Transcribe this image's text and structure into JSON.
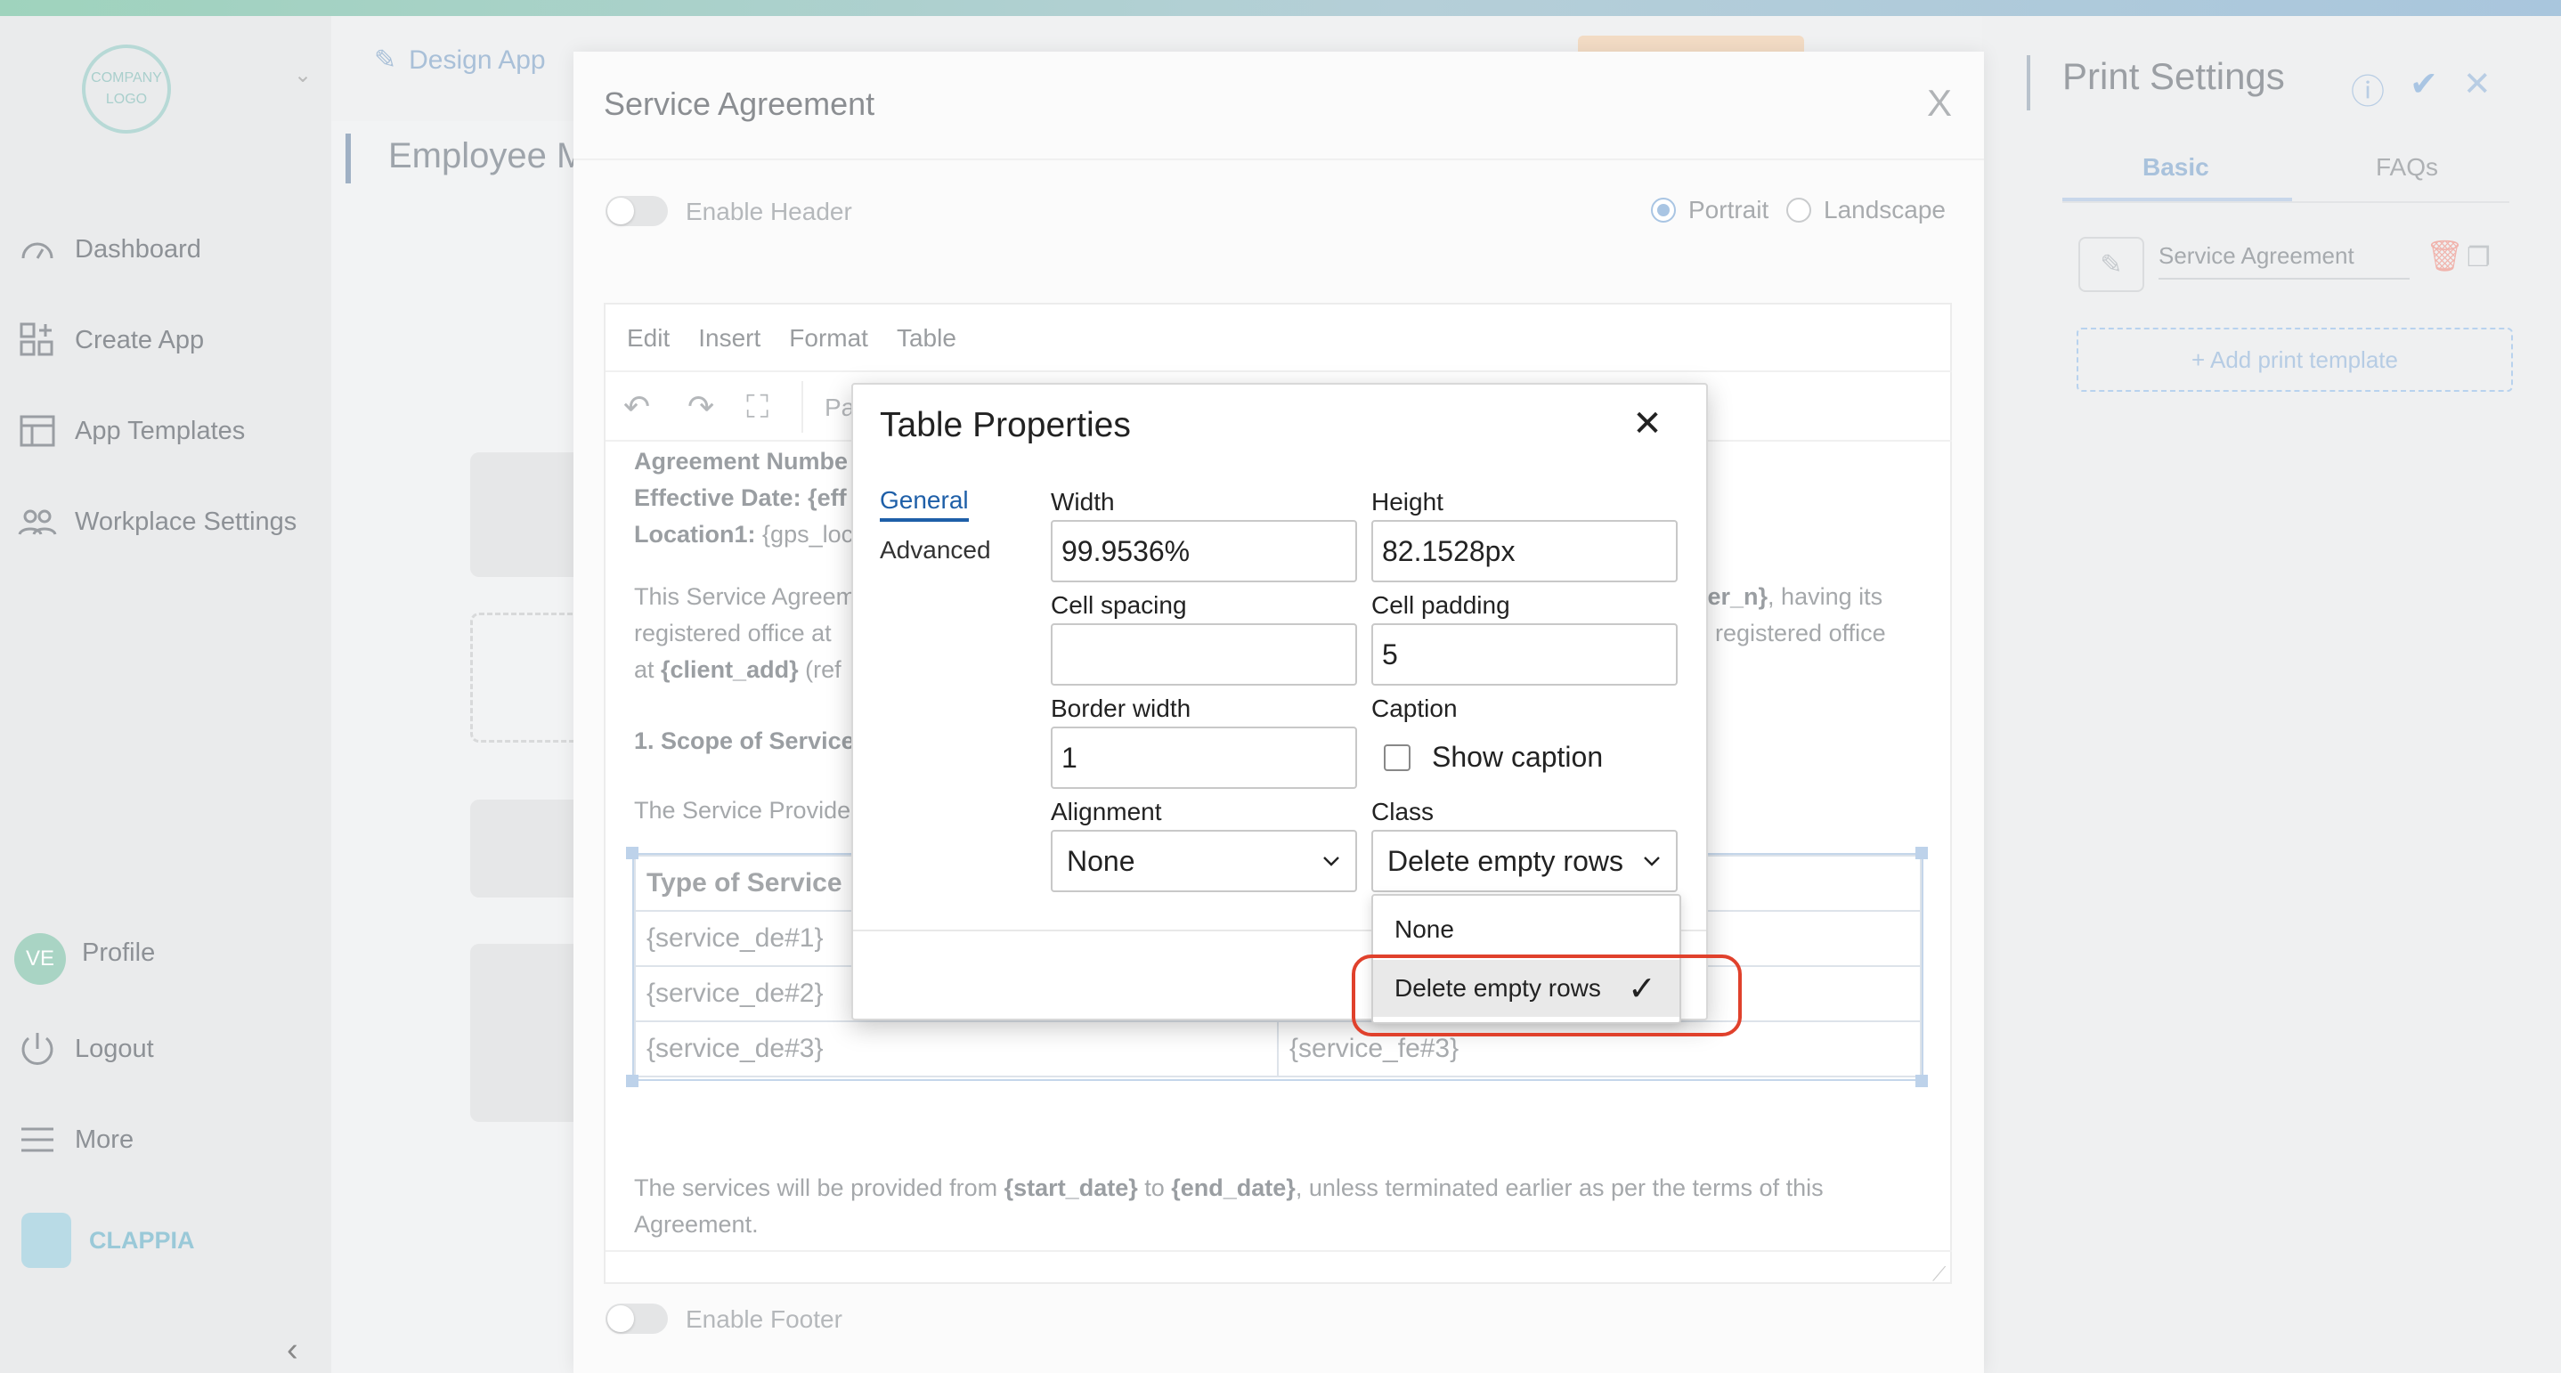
{
  "window": {
    "accent_color": "#1e5fa8",
    "highlight_color": "#e0412c"
  },
  "sidebar": {
    "logo_text": "COMPANY LOGO",
    "items": [
      {
        "label": "Dashboard",
        "icon": "dashboard-icon"
      },
      {
        "label": "Create App",
        "icon": "create-app-icon"
      },
      {
        "label": "App Templates",
        "icon": "templates-icon"
      },
      {
        "label": "Workplace Settings",
        "icon": "users-icon"
      }
    ],
    "bottom": {
      "avatar_initials": "VE",
      "profile": "Profile",
      "logout": "Logout",
      "more": "More",
      "brand": "CLAPPIA"
    }
  },
  "header": {
    "design_app": "Design App"
  },
  "page": {
    "title": "Employee M"
  },
  "print_settings": {
    "title": "Print Settings",
    "tabs": [
      "Basic",
      "FAQs"
    ],
    "template_name": "Service Agreement",
    "add_template": "+ Add print template"
  },
  "service_agreement": {
    "title": "Service Agreement",
    "close": "X",
    "enable_header": "Enable Header",
    "enable_footer": "Enable Footer",
    "orientation": {
      "portrait": "Portrait",
      "landscape": "Landscape",
      "selected": "Portrait"
    },
    "menu": [
      "Edit",
      "Insert",
      "Format",
      "Table"
    ],
    "toolbar_partial": "Pa",
    "doc": {
      "l1_label": "Agreement Numbe",
      "l2_label": "Effective Date: {eff",
      "l3_label": "Location1:",
      "l3_value": "{gps_loc",
      "p1_line1": "This Service Agreem",
      "p1_line1_right_bold": "ler_n}",
      "p1_line1_right": ", having its",
      "p1_line2": "registered office at",
      "p1_line2_right": "registered office",
      "p1_line3_pre": "at ",
      "p1_line3_bold": "{client_add}",
      "p1_line3_post": " (ref",
      "scope": "1. Scope of Service",
      "provider": "The Service Provide",
      "closing_1": "The services will be provided from ",
      "closing_start": "{start_date}",
      "closing_2": " to ",
      "closing_end": "{end_date}",
      "closing_3": ", unless terminated earlier as per the terms of this",
      "closing_4": "Agreement."
    },
    "table": {
      "header": "Type of Service",
      "rows": [
        [
          "{service_de#1}",
          ""
        ],
        [
          "{service_de#2}",
          ""
        ],
        [
          "{service_de#3}",
          "{service_fe#3}"
        ]
      ]
    }
  },
  "table_properties": {
    "title": "Table Properties",
    "close": "✕",
    "tabs": {
      "general": "General",
      "advanced": "Advanced",
      "active": "General"
    },
    "fields": {
      "width_label": "Width",
      "width_value": "99.9536%",
      "height_label": "Height",
      "height_value": "82.1528px",
      "cell_spacing_label": "Cell spacing",
      "cell_spacing_value": "",
      "cell_padding_label": "Cell padding",
      "cell_padding_value": "5",
      "border_width_label": "Border width",
      "border_width_value": "1",
      "caption_label": "Caption",
      "show_caption_label": "Show caption",
      "show_caption_checked": false,
      "alignment_label": "Alignment",
      "alignment_value": "None",
      "class_label": "Class",
      "class_value": "Delete empty rows"
    },
    "class_dropdown": {
      "options": [
        "None",
        "Delete empty rows"
      ],
      "selected": "Delete empty rows",
      "check": "✓"
    }
  }
}
